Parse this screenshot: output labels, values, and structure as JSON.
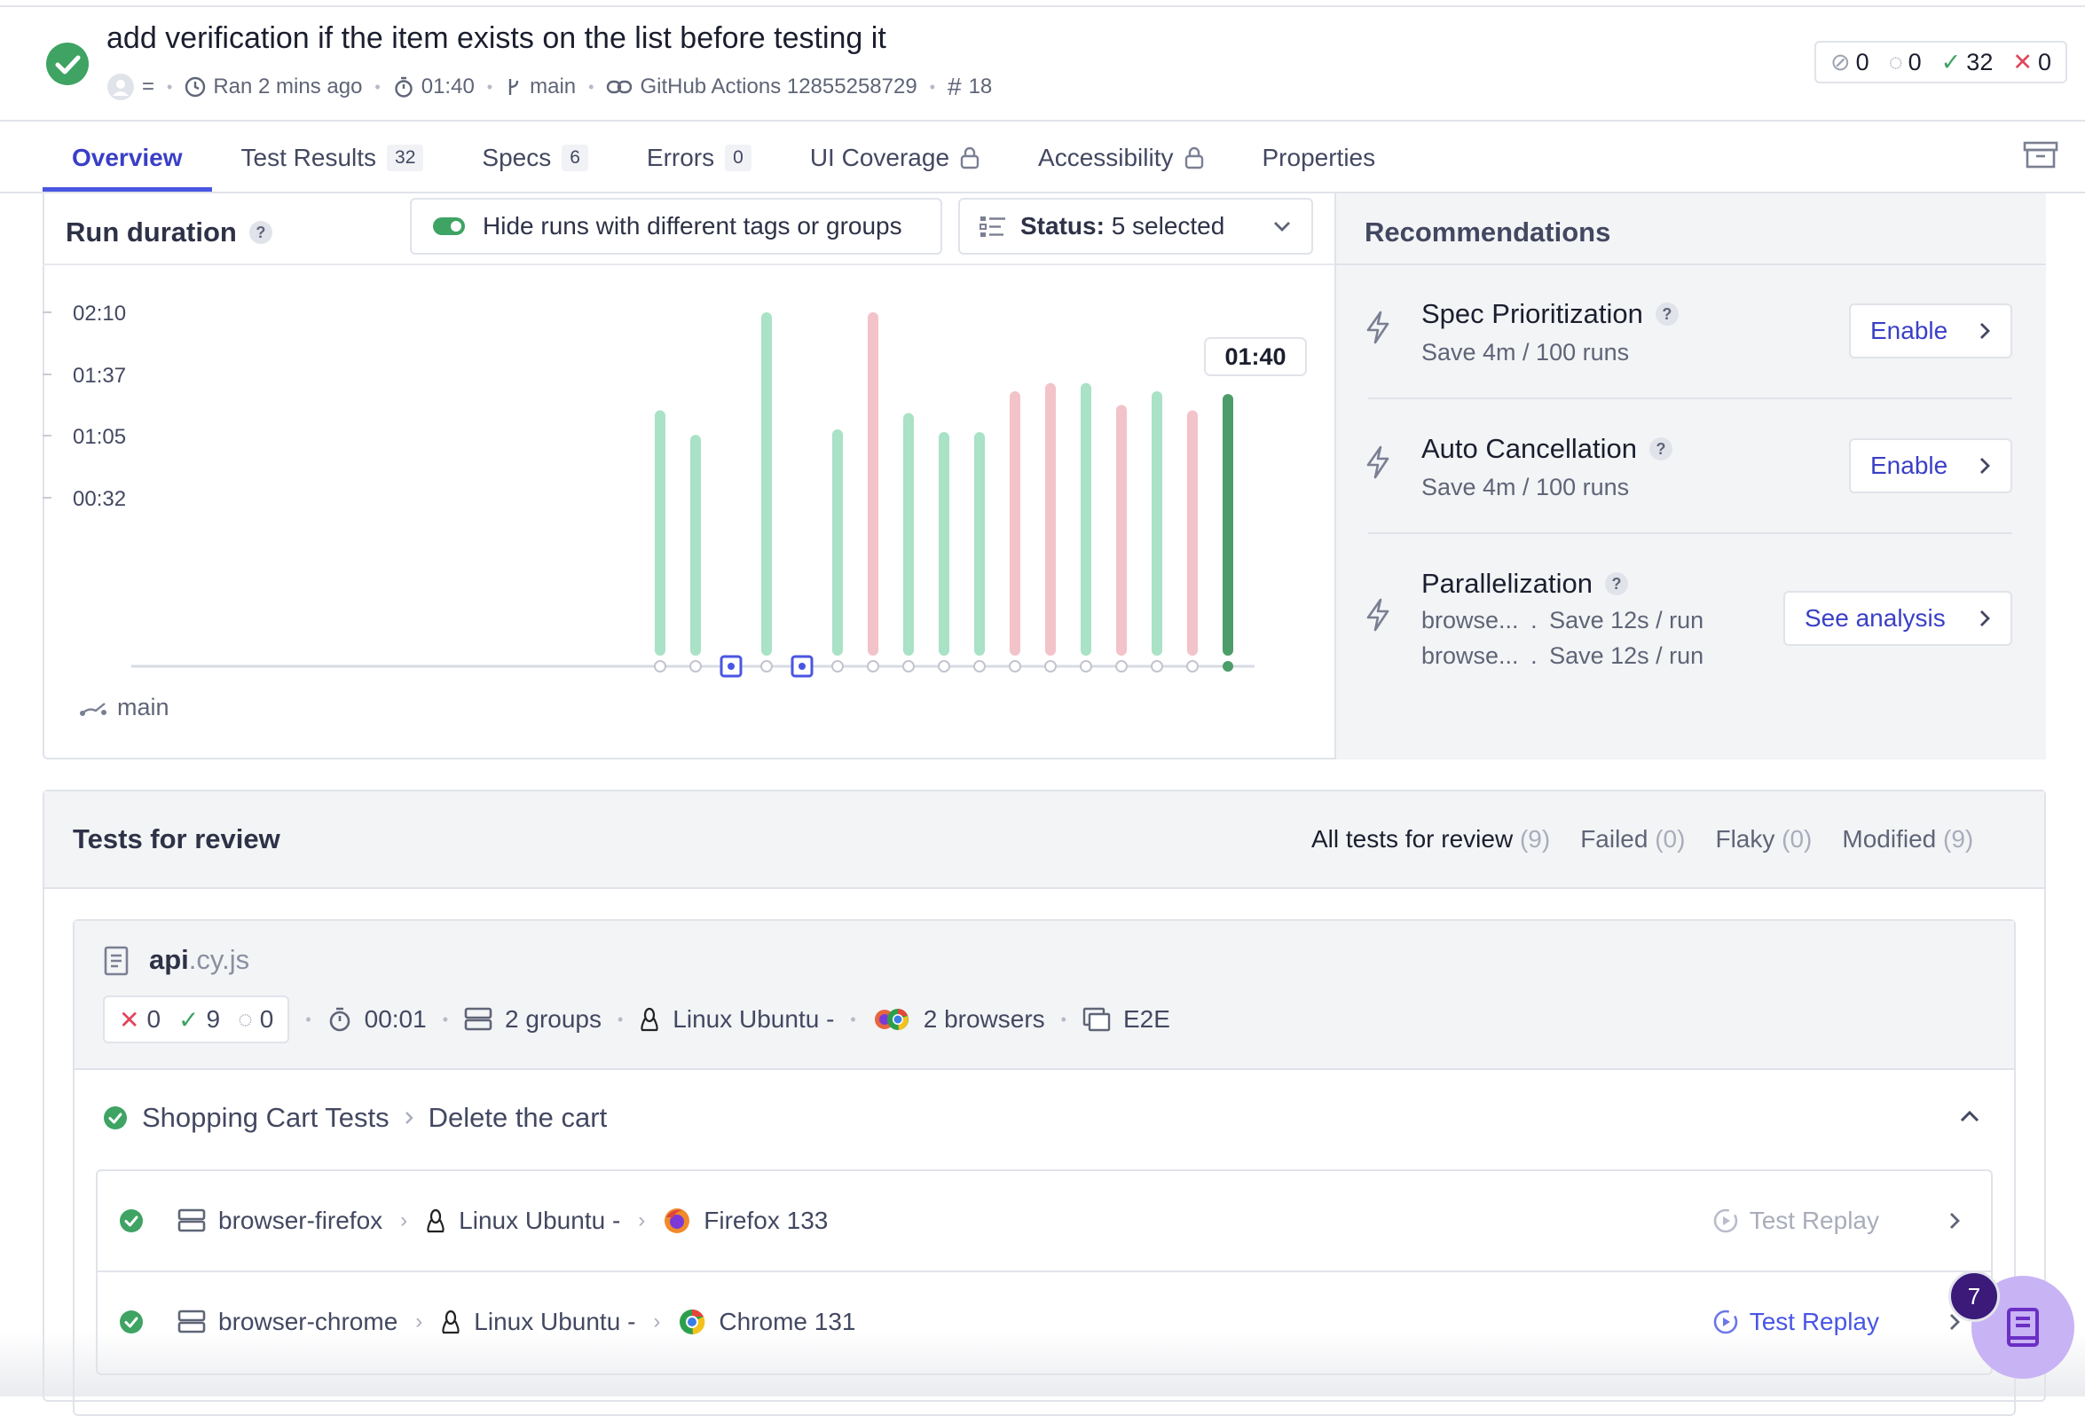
{
  "run": {
    "title": "add verification if the item exists on the list before testing it",
    "author": "=",
    "ran": "Ran 2 mins ago",
    "duration": "01:40",
    "branch": "main",
    "ci": "GitHub Actions 12855258729",
    "number": "18",
    "counts": {
      "skipped": "0",
      "pending": "0",
      "passed": "32",
      "failed": "0"
    }
  },
  "tabs": [
    {
      "label": "Overview"
    },
    {
      "label": "Test Results",
      "count": "32"
    },
    {
      "label": "Specs",
      "count": "6"
    },
    {
      "label": "Errors",
      "count": "0"
    },
    {
      "label": "UI Coverage"
    },
    {
      "label": "Accessibility"
    },
    {
      "label": "Properties"
    }
  ],
  "duration_card": {
    "title": "Run duration",
    "toggle_label": "Hide runs with different tags or groups",
    "status_prefix": "Status:",
    "status_value": "5 selected",
    "branch": "main",
    "tooltip": "01:40"
  },
  "chart_data": {
    "type": "bar",
    "title": "Run duration",
    "ytick_labels": [
      "02:10",
      "01:37",
      "01:05",
      "00:32"
    ],
    "ylim_seconds": [
      0,
      130
    ],
    "legend": "none",
    "grid": false,
    "bars": [
      {
        "seconds": 94,
        "status": "passed"
      },
      {
        "seconds": 85,
        "status": "passed"
      },
      {
        "seconds": 0,
        "status": "none"
      },
      {
        "seconds": 130,
        "status": "passed"
      },
      {
        "seconds": 0,
        "status": "none"
      },
      {
        "seconds": 87,
        "status": "passed"
      },
      {
        "seconds": 130,
        "status": "failed"
      },
      {
        "seconds": 93,
        "status": "passed"
      },
      {
        "seconds": 86,
        "status": "passed"
      },
      {
        "seconds": 86,
        "status": "passed"
      },
      {
        "seconds": 101,
        "status": "failed"
      },
      {
        "seconds": 104,
        "status": "failed"
      },
      {
        "seconds": 104,
        "status": "passed"
      },
      {
        "seconds": 96,
        "status": "failed"
      },
      {
        "seconds": 101,
        "status": "passed"
      },
      {
        "seconds": 94,
        "status": "failed"
      },
      {
        "seconds": 100,
        "status": "current"
      }
    ],
    "highlighted_label": "01:40",
    "colors": {
      "passed": "#a9e2c6",
      "failed": "#f2c3c9",
      "current": "#4c9d6a",
      "marker": "#4956e3"
    }
  },
  "recommendations": {
    "title": "Recommendations",
    "items": [
      {
        "name": "Spec Prioritization",
        "sub": "Save 4m / 100 runs",
        "button": "Enable"
      },
      {
        "name": "Auto Cancellation",
        "sub": "Save 4m / 100 runs",
        "button": "Enable"
      },
      {
        "name": "Parallelization",
        "lines": [
          {
            "group": "browse...",
            "save": "Save 12s / run"
          },
          {
            "group": "browse...",
            "save": "Save 12s / run"
          }
        ],
        "button": "See analysis"
      }
    ]
  },
  "review": {
    "title": "Tests for review",
    "filters": [
      {
        "label": "All tests for review",
        "count": "(9)"
      },
      {
        "label": "Failed",
        "count": "(0)"
      },
      {
        "label": "Flaky",
        "count": "(0)"
      },
      {
        "label": "Modified",
        "count": "(9)"
      }
    ],
    "spec": {
      "base": "api",
      "ext": ".cy.js",
      "failed": "0",
      "passed": "9",
      "pending": "0",
      "duration": "00:01",
      "groups": "2 groups",
      "os": "Linux Ubuntu -",
      "browsers": "2 browsers",
      "type": "E2E"
    },
    "test": {
      "suite": "Shopping Cart Tests",
      "name": "Delete the cart"
    },
    "rows": [
      {
        "group": "browser-firefox",
        "os": "Linux Ubuntu -",
        "browser": "Firefox 133",
        "replay": "Test Replay",
        "replay_enabled": false
      },
      {
        "group": "browser-chrome",
        "os": "Linux Ubuntu -",
        "browser": "Chrome 131",
        "replay": "Test Replay",
        "replay_enabled": true
      }
    ]
  },
  "fab": {
    "badge": "7"
  }
}
